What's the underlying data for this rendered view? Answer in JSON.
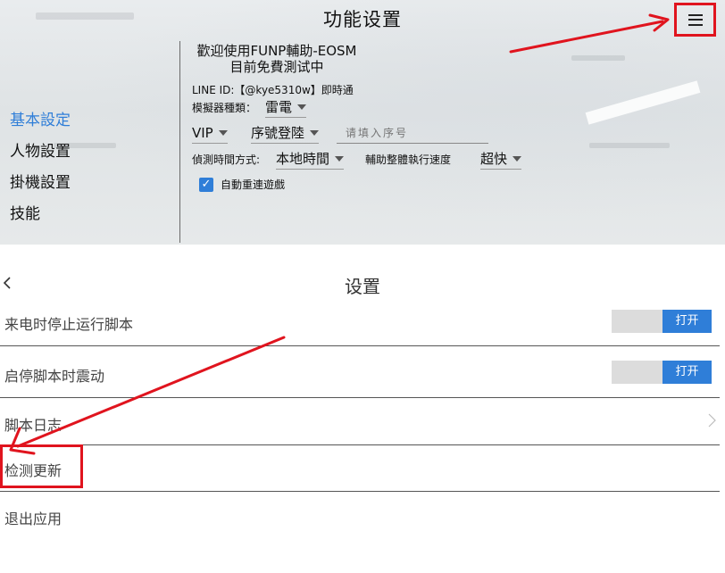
{
  "overlay": {
    "title": "功能设置",
    "nav": [
      "基本設定",
      "人物設置",
      "掛機設置",
      "技能"
    ],
    "welcome_line1": "歡迎使用FUNP輔助-EOSM",
    "welcome_line2": "目前免費測试中",
    "line_id": "LINE ID:【@kye5310w】即時通",
    "emulator_label": "模擬器種類：",
    "emulator_value": "雷電",
    "tier_value": "VIP",
    "login_value": "序號登陸",
    "serial_placeholder": "请填入序号",
    "detect_label": "偵測時間方式:",
    "detect_value": "本地時間",
    "speed_label": "輔助整體執行速度",
    "speed_value": "超快",
    "auto_reconnect_label": "自動重連遊戲",
    "auto_reconnect_checked": true
  },
  "settings": {
    "title": "设置",
    "rows": [
      {
        "label": "来电时停止运行脚本",
        "toggle": "打开"
      },
      {
        "label": "启停脚本时震动",
        "toggle": "打开"
      },
      {
        "label": "脚本日志"
      },
      {
        "label": "检测更新"
      },
      {
        "label": "退出应用"
      }
    ]
  },
  "colors": {
    "accent_blue": "#2f7ed8",
    "annotation_red": "#e0141e"
  },
  "icons": {
    "menu": "hamburger-icon",
    "back": "chevron-left-icon",
    "row_arrow": "chevron-right-icon",
    "check": "checkmark-icon"
  }
}
